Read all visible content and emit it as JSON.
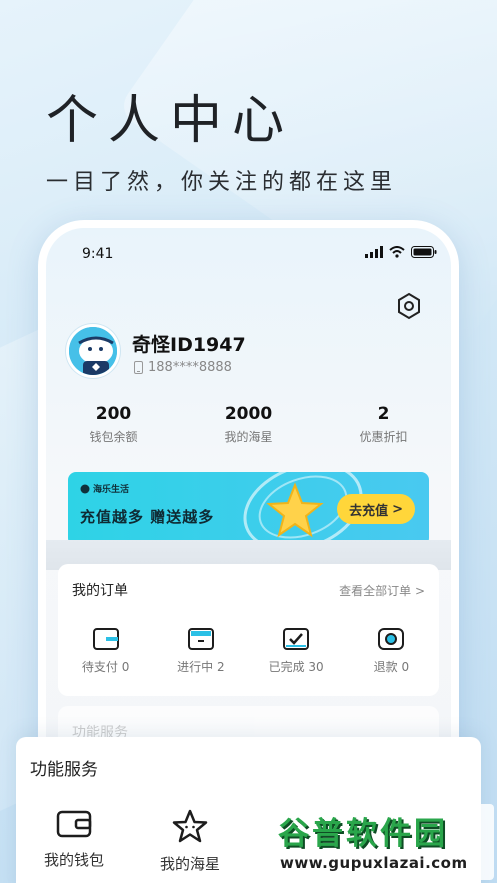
{
  "hero": {
    "title": "个人中心",
    "subtitle": "一目了然，你关注的都在这里"
  },
  "status_bar": {
    "time": "9:41"
  },
  "profile": {
    "name": "奇怪ID1947",
    "phone": "188****8888"
  },
  "stats": [
    {
      "value": "200",
      "label": "钱包余额"
    },
    {
      "value": "2000",
      "label": "我的海星"
    },
    {
      "value": "2",
      "label": "优惠折扣"
    }
  ],
  "banner": {
    "logo_text": "海乐生活",
    "text": "充值越多 赠送越多",
    "button_label": "去充值",
    "button_arrow": ">"
  },
  "orders": {
    "title": "我的订单",
    "view_all": "查看全部订单 >",
    "items": [
      {
        "label": "待支付 0",
        "icon": "wallet-card-icon"
      },
      {
        "label": "进行中 2",
        "icon": "in-progress-icon"
      },
      {
        "label": "已完成 30",
        "icon": "check-box-icon"
      },
      {
        "label": "退款 0",
        "icon": "refund-icon"
      }
    ]
  },
  "ghost_section": {
    "title": "功能服务"
  },
  "services": {
    "title": "功能服务",
    "items": [
      {
        "label": "我的钱包",
        "icon": "wallet-icon"
      },
      {
        "label": "我的海星",
        "icon": "star-icon"
      }
    ]
  },
  "watermark": {
    "main": "谷普软件园",
    "url": "www.gupuxlazai.com"
  },
  "colors": {
    "banner": "#2ed3e6",
    "banner_button": "#ffd63a",
    "watermark_green": "#2aa64b"
  }
}
